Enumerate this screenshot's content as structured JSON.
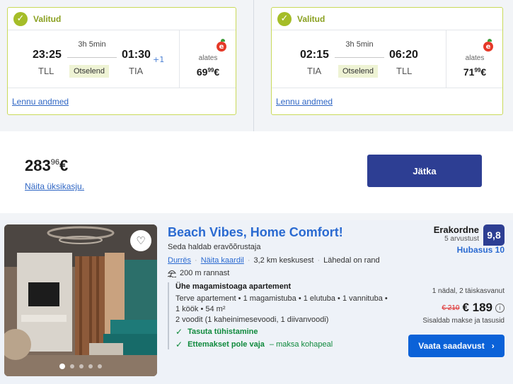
{
  "outbound": {
    "status": "Valitud",
    "dep_time": "23:25",
    "dep_code": "TLL",
    "arr_time": "01:30",
    "day_offset": "+1",
    "arr_code": "TIA",
    "duration": "3h 5min",
    "stops": "Otselend",
    "airline_icon": "e-airline-logo",
    "from_label": "alates",
    "price_main": "69",
    "price_cents": "99",
    "price_currency": "€",
    "details_link": "Lennu andmed"
  },
  "inbound": {
    "status": "Valitud",
    "dep_time": "02:15",
    "dep_code": "TIA",
    "arr_time": "06:20",
    "arr_code": "TLL",
    "duration": "3h 5min",
    "stops": "Otselend",
    "airline_icon": "e-airline-logo",
    "from_label": "alates",
    "price_main": "71",
    "price_cents": "99",
    "price_currency": "€",
    "details_link": "Lennu andmed"
  },
  "summary": {
    "total_main": "283",
    "total_cents": "96",
    "total_currency": "€",
    "unit_price_link": "Näita üksikasju.",
    "continue_label": "Jätka"
  },
  "hotel": {
    "name": "Beach Vibes, Home Comfort!",
    "managed_by": "Seda haldab eravõõrustaja",
    "city": "Durrës",
    "map_link": "Näita kaardil",
    "distance_center": "3,2 km keskusest",
    "near_beach": "Lähedal on rand",
    "beach_distance": "200 m rannast",
    "room_title": "Ühe magamistoaga apartement",
    "room_desc": "Terve apartement • 1 magamistuba • 1 elutuba • 1 vannituba • 1 köök • 54 m²",
    "beds": "2 voodit (1 kaheinimesevoodi, 1 diivanvoodi)",
    "perk1": "Tasuta tühistamine",
    "perk2_bold": "Ettemakset pole vaja",
    "perk2_rest": "– maksa kohapeal",
    "rating_word": "Erakordne",
    "reviews": "5 arvustust",
    "score": "9,8",
    "sub_score": "Hubasus 10",
    "stay": "1 nädal, 2 täiskasvanut",
    "old_price": "€ 210",
    "new_price": "€ 189",
    "taxes": "Sisaldab makse ja tasusid",
    "availability_label": "Vaata saadavust",
    "photo_count": 5,
    "photo_index": 1
  },
  "colors": {
    "selected_green": "#a5bd28",
    "primary_navy": "#2d3e93",
    "link_blue": "#2a6ad1",
    "cta_blue": "#0b62d8",
    "perk_green": "#108a3d"
  }
}
